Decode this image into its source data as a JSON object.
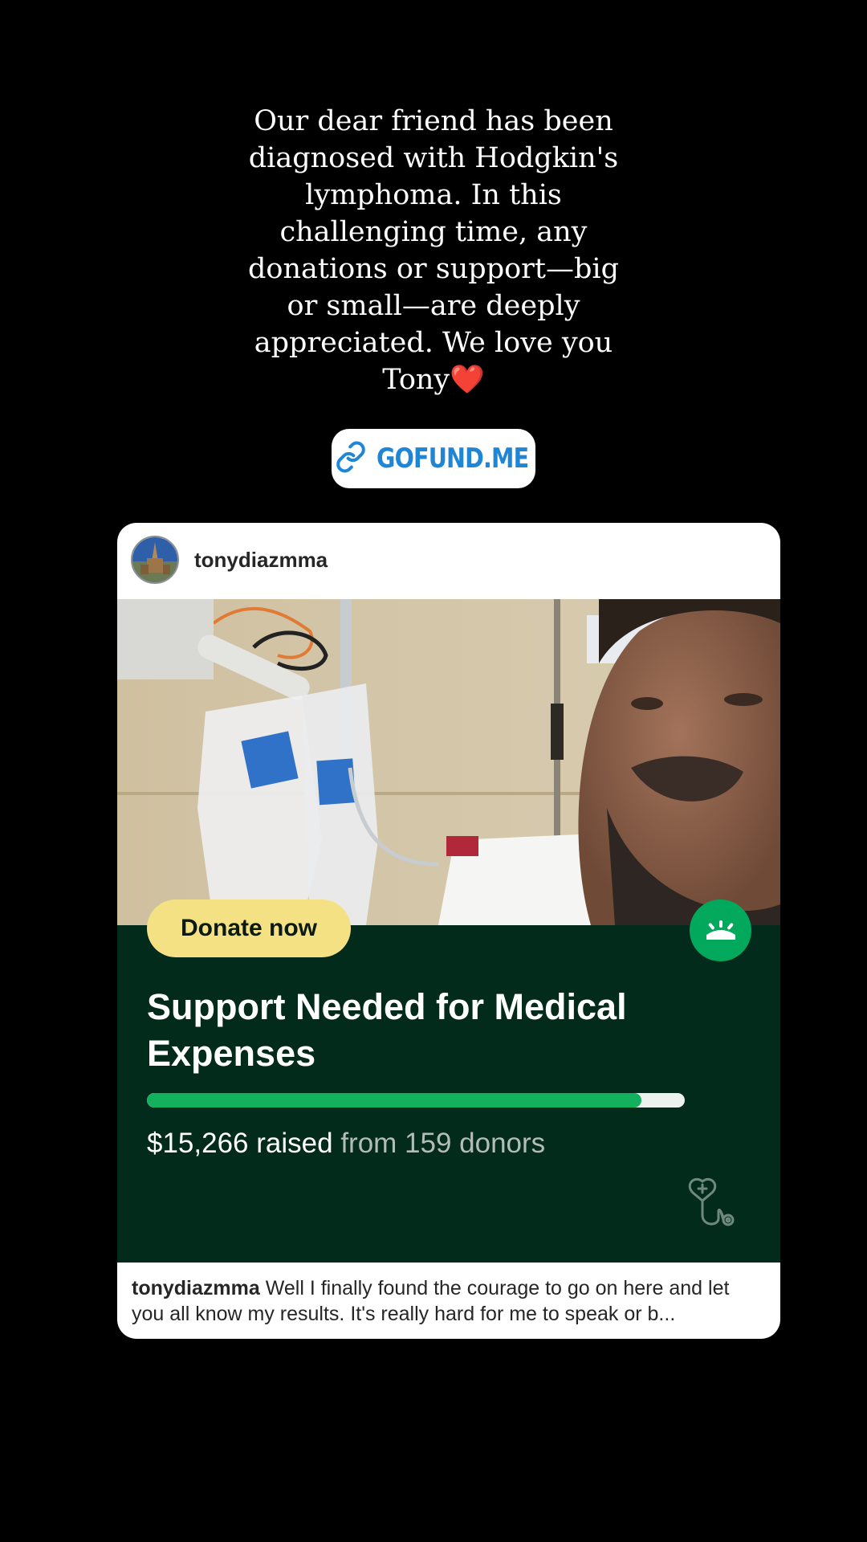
{
  "story": {
    "caption": "Our dear friend has been diagnosed with Hodgkin's lymphoma. In this challenging time, any donations or support—big or small—are deeply appreciated. We love you Tony",
    "caption_emoji": "❤️"
  },
  "link_sticker": {
    "label": "GOFUND.ME",
    "icon": "link-icon",
    "color": "#1f86d6"
  },
  "post_card": {
    "username": "tonydiazmma",
    "fundraiser": {
      "donate_label": "Donate now",
      "title": "Support Needed for Medical Expenses",
      "progress_fraction": 0.92,
      "raised_text": "$15,266 raised",
      "donors_text": "from 159 donors",
      "panel_color": "#022b1c",
      "accent_color": "#13b05d",
      "button_color": "#f4e183"
    },
    "caption_user": "tonydiazmma",
    "caption_text": "Well I finally found the courage to go on here and let you all know my results. It's really hard for me to speak or b..."
  }
}
